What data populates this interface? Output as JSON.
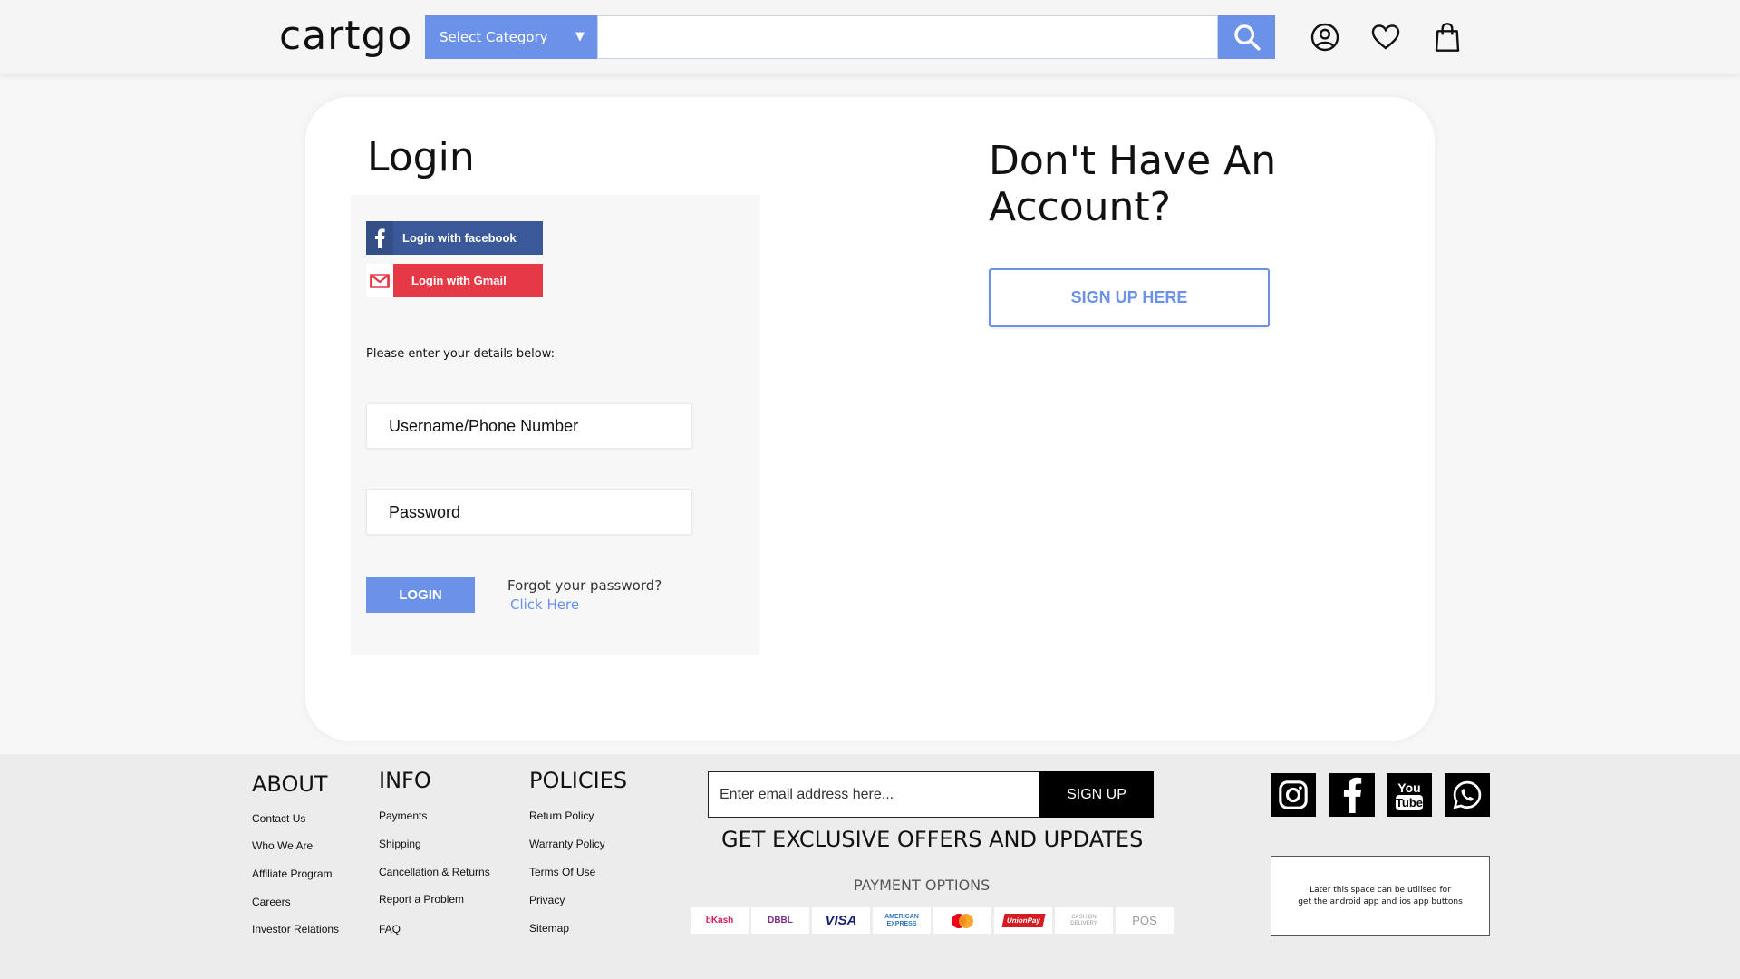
{
  "header": {
    "logo": "cartgo",
    "category_label": "Select Category",
    "search_placeholder": "",
    "icons": [
      "search-icon",
      "user-icon",
      "heart-icon",
      "shopping-bag-icon"
    ]
  },
  "login": {
    "title": "Login",
    "facebook_label": "Login with facebook",
    "gmail_label": "Login with Gmail",
    "details_text": "Please enter your details below:",
    "username_placeholder": "Username/Phone Number",
    "password_placeholder": "Password",
    "login_button": "LOGIN",
    "forgot_text": "Forgot your password?",
    "click_here": "Click Here"
  },
  "signup": {
    "title": "Don't Have An Account?",
    "button": "SIGN UP HERE"
  },
  "footer": {
    "about": {
      "title": "ABOUT",
      "links": [
        "Contact Us",
        "Who We Are",
        "Affiliate Program",
        "Careers",
        "Investor Relations"
      ]
    },
    "info": {
      "title": "INFO",
      "links": [
        "Payments",
        "Shipping",
        "Cancellation & Returns",
        "Report a Problem",
        "FAQ"
      ]
    },
    "policies": {
      "title": "POLICIES",
      "links": [
        "Return Policy",
        "Warranty Policy",
        "Terms Of Use",
        "Privacy",
        "Sitemap"
      ]
    },
    "newsletter": {
      "email_placeholder": "Enter email address here...",
      "signup_button": "SIGN UP",
      "offers_text": "GET EXCLUSIVE OFFERS AND UPDATES"
    },
    "payment": {
      "title": "PAYMENT OPTIONS",
      "methods": [
        "bKash",
        "DBBL",
        "VISA",
        "AMERICAN EXPRESS",
        "mastercard",
        "UnionPay",
        "CASH ON DELIVERY",
        "POS"
      ]
    },
    "social_icons": [
      "instagram-icon",
      "facebook-icon",
      "youtube-icon",
      "whatsapp-icon"
    ],
    "app_note_line1": "Later this space can be utilised for",
    "app_note_line2": "get the android app and ios app  buttons"
  },
  "colors": {
    "accent": "#6b92e8",
    "facebook": "#3b5998",
    "gmail": "#e63946"
  }
}
